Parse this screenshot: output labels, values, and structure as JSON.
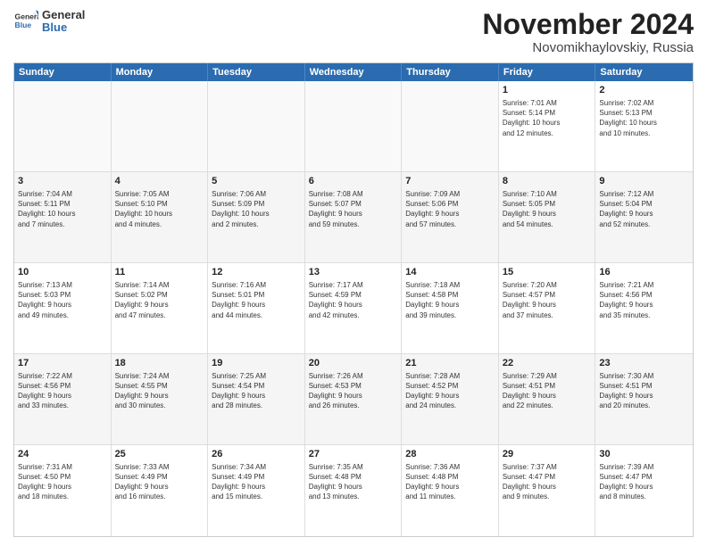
{
  "logo": {
    "line1": "General",
    "line2": "Blue"
  },
  "title": "November 2024",
  "subtitle": "Novomikhaylovskiy, Russia",
  "days": [
    "Sunday",
    "Monday",
    "Tuesday",
    "Wednesday",
    "Thursday",
    "Friday",
    "Saturday"
  ],
  "weeks": [
    [
      {
        "day": "",
        "info": ""
      },
      {
        "day": "",
        "info": ""
      },
      {
        "day": "",
        "info": ""
      },
      {
        "day": "",
        "info": ""
      },
      {
        "day": "",
        "info": ""
      },
      {
        "day": "1",
        "info": "Sunrise: 7:01 AM\nSunset: 5:14 PM\nDaylight: 10 hours\nand 12 minutes."
      },
      {
        "day": "2",
        "info": "Sunrise: 7:02 AM\nSunset: 5:13 PM\nDaylight: 10 hours\nand 10 minutes."
      }
    ],
    [
      {
        "day": "3",
        "info": "Sunrise: 7:04 AM\nSunset: 5:11 PM\nDaylight: 10 hours\nand 7 minutes."
      },
      {
        "day": "4",
        "info": "Sunrise: 7:05 AM\nSunset: 5:10 PM\nDaylight: 10 hours\nand 4 minutes."
      },
      {
        "day": "5",
        "info": "Sunrise: 7:06 AM\nSunset: 5:09 PM\nDaylight: 10 hours\nand 2 minutes."
      },
      {
        "day": "6",
        "info": "Sunrise: 7:08 AM\nSunset: 5:07 PM\nDaylight: 9 hours\nand 59 minutes."
      },
      {
        "day": "7",
        "info": "Sunrise: 7:09 AM\nSunset: 5:06 PM\nDaylight: 9 hours\nand 57 minutes."
      },
      {
        "day": "8",
        "info": "Sunrise: 7:10 AM\nSunset: 5:05 PM\nDaylight: 9 hours\nand 54 minutes."
      },
      {
        "day": "9",
        "info": "Sunrise: 7:12 AM\nSunset: 5:04 PM\nDaylight: 9 hours\nand 52 minutes."
      }
    ],
    [
      {
        "day": "10",
        "info": "Sunrise: 7:13 AM\nSunset: 5:03 PM\nDaylight: 9 hours\nand 49 minutes."
      },
      {
        "day": "11",
        "info": "Sunrise: 7:14 AM\nSunset: 5:02 PM\nDaylight: 9 hours\nand 47 minutes."
      },
      {
        "day": "12",
        "info": "Sunrise: 7:16 AM\nSunset: 5:01 PM\nDaylight: 9 hours\nand 44 minutes."
      },
      {
        "day": "13",
        "info": "Sunrise: 7:17 AM\nSunset: 4:59 PM\nDaylight: 9 hours\nand 42 minutes."
      },
      {
        "day": "14",
        "info": "Sunrise: 7:18 AM\nSunset: 4:58 PM\nDaylight: 9 hours\nand 39 minutes."
      },
      {
        "day": "15",
        "info": "Sunrise: 7:20 AM\nSunset: 4:57 PM\nDaylight: 9 hours\nand 37 minutes."
      },
      {
        "day": "16",
        "info": "Sunrise: 7:21 AM\nSunset: 4:56 PM\nDaylight: 9 hours\nand 35 minutes."
      }
    ],
    [
      {
        "day": "17",
        "info": "Sunrise: 7:22 AM\nSunset: 4:56 PM\nDaylight: 9 hours\nand 33 minutes."
      },
      {
        "day": "18",
        "info": "Sunrise: 7:24 AM\nSunset: 4:55 PM\nDaylight: 9 hours\nand 30 minutes."
      },
      {
        "day": "19",
        "info": "Sunrise: 7:25 AM\nSunset: 4:54 PM\nDaylight: 9 hours\nand 28 minutes."
      },
      {
        "day": "20",
        "info": "Sunrise: 7:26 AM\nSunset: 4:53 PM\nDaylight: 9 hours\nand 26 minutes."
      },
      {
        "day": "21",
        "info": "Sunrise: 7:28 AM\nSunset: 4:52 PM\nDaylight: 9 hours\nand 24 minutes."
      },
      {
        "day": "22",
        "info": "Sunrise: 7:29 AM\nSunset: 4:51 PM\nDaylight: 9 hours\nand 22 minutes."
      },
      {
        "day": "23",
        "info": "Sunrise: 7:30 AM\nSunset: 4:51 PM\nDaylight: 9 hours\nand 20 minutes."
      }
    ],
    [
      {
        "day": "24",
        "info": "Sunrise: 7:31 AM\nSunset: 4:50 PM\nDaylight: 9 hours\nand 18 minutes."
      },
      {
        "day": "25",
        "info": "Sunrise: 7:33 AM\nSunset: 4:49 PM\nDaylight: 9 hours\nand 16 minutes."
      },
      {
        "day": "26",
        "info": "Sunrise: 7:34 AM\nSunset: 4:49 PM\nDaylight: 9 hours\nand 15 minutes."
      },
      {
        "day": "27",
        "info": "Sunrise: 7:35 AM\nSunset: 4:48 PM\nDaylight: 9 hours\nand 13 minutes."
      },
      {
        "day": "28",
        "info": "Sunrise: 7:36 AM\nSunset: 4:48 PM\nDaylight: 9 hours\nand 11 minutes."
      },
      {
        "day": "29",
        "info": "Sunrise: 7:37 AM\nSunset: 4:47 PM\nDaylight: 9 hours\nand 9 minutes."
      },
      {
        "day": "30",
        "info": "Sunrise: 7:39 AM\nSunset: 4:47 PM\nDaylight: 9 hours\nand 8 minutes."
      }
    ]
  ]
}
